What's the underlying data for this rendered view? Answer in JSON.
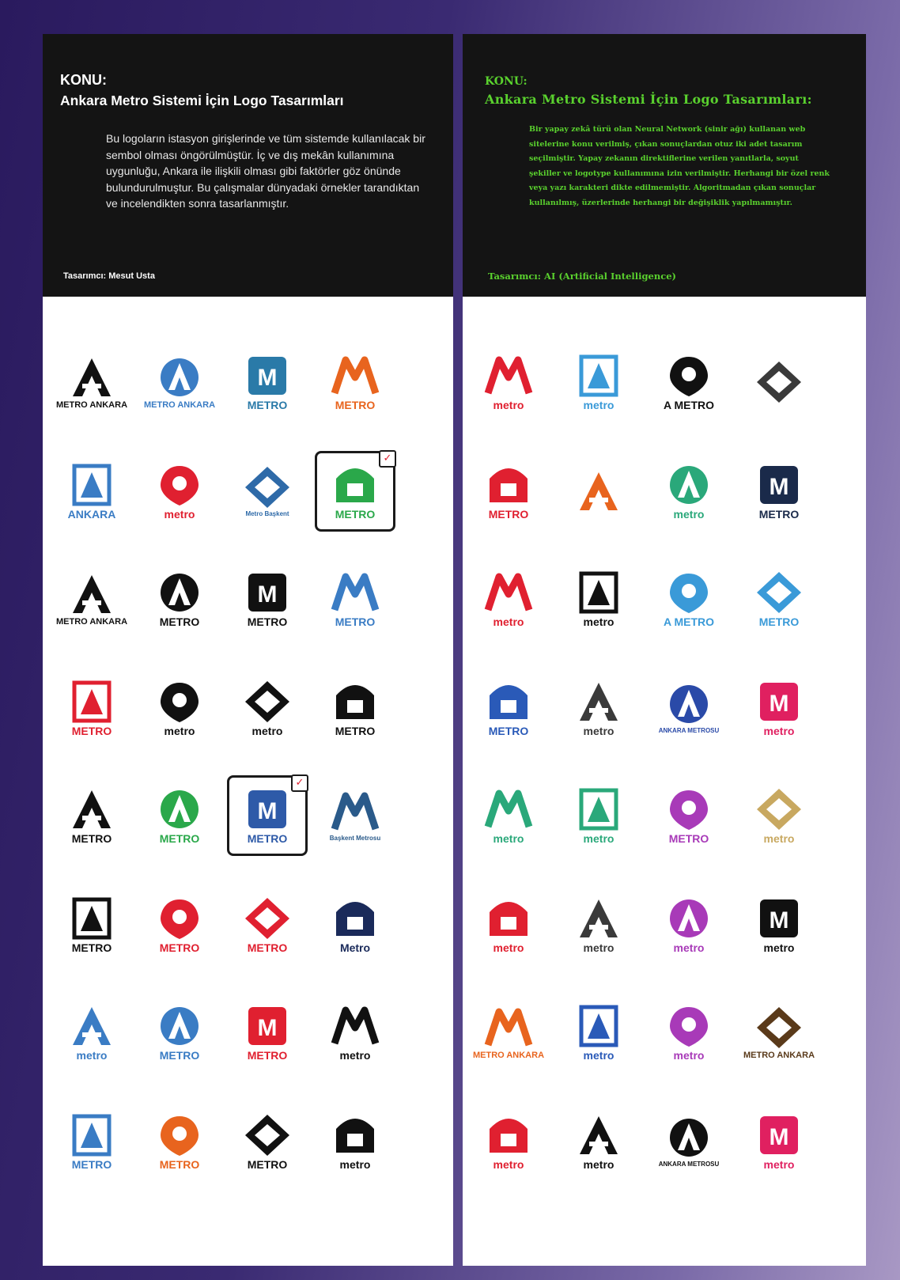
{
  "left": {
    "label": "KONU:",
    "title": "Ankara Metro Sistemi İçin Logo Tasarımları",
    "body": "Bu logoların istasyon girişlerinde ve tüm sistemde kullanılacak bir sembol olması öngörülmüştür. İç ve dış mekân kullanımına uygunluğu, Ankara ile ilişkili olması gibi faktörler göz önünde bulundurulmuştur. Bu çalışmalar dünyadaki örnekler tarandıktan ve incelendikten sonra tasarlanmıştır.",
    "designer": "Tasarımcı: Mesut Usta",
    "logos": [
      {
        "caption": "METRO ANKARA",
        "accent": "#111111"
      },
      {
        "caption": "METRO ANKARA",
        "accent": "#3a7cc4"
      },
      {
        "caption": "METRO",
        "accent": "#2a7aa8"
      },
      {
        "caption": "METRO",
        "accent": "#e8641e"
      },
      {
        "caption": "ANKARA",
        "accent": "#3a7cc4"
      },
      {
        "caption": "metro",
        "accent": "#e02030"
      },
      {
        "caption": "Metro Başkent",
        "accent": "#2e6aa8"
      },
      {
        "caption": "METRO",
        "accent": "#2aa84a",
        "selected": true
      },
      {
        "caption": "METRO ANKARA",
        "accent": "#111111"
      },
      {
        "caption": "METRO",
        "accent": "#111111"
      },
      {
        "caption": "METRO",
        "accent": "#111111"
      },
      {
        "caption": "METRO",
        "accent": "#3a7cc4"
      },
      {
        "caption": "METRO",
        "accent": "#e02030"
      },
      {
        "caption": "metro",
        "accent": "#111111"
      },
      {
        "caption": "metro",
        "accent": "#111111"
      },
      {
        "caption": "METRO",
        "accent": "#111111"
      },
      {
        "caption": "METRO",
        "accent": "#111111"
      },
      {
        "caption": "METRO",
        "accent": "#2aa84a"
      },
      {
        "caption": "METRO",
        "accent": "#2e5aa8",
        "selected": true
      },
      {
        "caption": "Başkent Metrosu",
        "accent": "#2a5a8a"
      },
      {
        "caption": "METRO",
        "accent": "#111111"
      },
      {
        "caption": "METRO",
        "accent": "#e02030"
      },
      {
        "caption": "METRO",
        "accent": "#e02030"
      },
      {
        "caption": "Metro",
        "accent": "#1a2a5a"
      },
      {
        "caption": "metro",
        "accent": "#3a7cc4"
      },
      {
        "caption": "METRO",
        "accent": "#3a7cc4"
      },
      {
        "caption": "METRO",
        "accent": "#e02030"
      },
      {
        "caption": "metro",
        "accent": "#111111"
      },
      {
        "caption": "METRO",
        "accent": "#3a7cc4"
      },
      {
        "caption": "METRO",
        "accent": "#e8641e"
      },
      {
        "caption": "METRO",
        "accent": "#111111"
      },
      {
        "caption": "metro",
        "accent": "#111111"
      }
    ]
  },
  "right": {
    "label": "KONU:",
    "title": "Ankara Metro Sistemi İçin Logo Tasarımları:",
    "body": "Bir yapay zekâ türü olan Neural Network (sinir ağı) kullanan web sitelerine konu verilmiş, çıkan sonuçlardan otuz iki adet tasarım seçilmiştir. Yapay zekanın direktiflerine verilen yanıtlarla, soyut şekiller ve logotype kullanımına izin verilmiştir. Herhangi bir özel renk veya yazı karakteri dikte edilmemiştir. Algoritmadan çıkan sonuçlar kullanılmış, üzerlerinde herhangi bir değişiklik yapılmamıştır.",
    "designer": "Tasarımcı: AI (Artificial Intelligence)",
    "logos": [
      {
        "caption": "metro",
        "accent": "#e02030"
      },
      {
        "caption": "metro",
        "accent": "#3a9ad8"
      },
      {
        "caption": "A METRO",
        "accent": "#111111"
      },
      {
        "caption": "",
        "accent": "#3a3a3a"
      },
      {
        "caption": "METRO",
        "accent": "#e02030"
      },
      {
        "caption": "",
        "accent": "#e8641e"
      },
      {
        "caption": "metro",
        "accent": "#2aa87a"
      },
      {
        "caption": "METRO",
        "accent": "#1a2a4a"
      },
      {
        "caption": "metro",
        "accent": "#e02030"
      },
      {
        "caption": "metro",
        "accent": "#111111"
      },
      {
        "caption": "A METRO",
        "accent": "#3a9ad8"
      },
      {
        "caption": "METRO",
        "accent": "#3a9ad8"
      },
      {
        "caption": "METRO",
        "accent": "#2a5ab8"
      },
      {
        "caption": "metro",
        "accent": "#3a3a3a"
      },
      {
        "caption": "ANKARA METROSU",
        "accent": "#2a4aa8"
      },
      {
        "caption": "metro",
        "accent": "#e02060"
      },
      {
        "caption": "metro",
        "accent": "#2aa87a"
      },
      {
        "caption": "metro",
        "accent": "#2aa87a"
      },
      {
        "caption": "METRO",
        "accent": "#a83ab8"
      },
      {
        "caption": "metro",
        "accent": "#c8a860"
      },
      {
        "caption": "metro",
        "accent": "#e02030"
      },
      {
        "caption": "metro",
        "accent": "#3a3a3a"
      },
      {
        "caption": "metro",
        "accent": "#a83ab8"
      },
      {
        "caption": "metro",
        "accent": "#111111"
      },
      {
        "caption": "METRO ANKARA",
        "accent": "#e8641e"
      },
      {
        "caption": "metro",
        "accent": "#2a5ab8"
      },
      {
        "caption": "metro",
        "accent": "#a83ab8"
      },
      {
        "caption": "METRO ANKARA",
        "accent": "#5a3a1a"
      },
      {
        "caption": "metro",
        "accent": "#e02030"
      },
      {
        "caption": "metro",
        "accent": "#111111"
      },
      {
        "caption": "ANKARA METROSU",
        "accent": "#111111"
      },
      {
        "caption": "metro",
        "accent": "#e02060"
      }
    ]
  }
}
